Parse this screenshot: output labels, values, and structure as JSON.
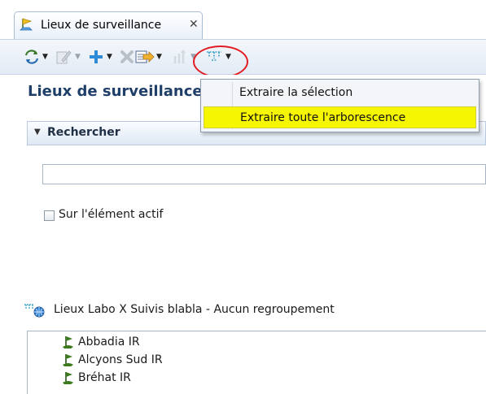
{
  "tab": {
    "label": "Lieux de surveillance",
    "close_glyph": "✕",
    "icon": "flag-icon"
  },
  "toolbar": {
    "buttons": [
      {
        "icon": "refresh-icon"
      },
      {
        "icon": "edit-icon",
        "disabled": true
      },
      {
        "icon": "add-icon"
      },
      {
        "icon": "delete-icon",
        "disabled": true
      },
      {
        "icon": "export-icon"
      },
      {
        "icon": "move-icon",
        "disabled": true
      },
      {
        "icon": "filter-tree-icon"
      }
    ],
    "highlight_color": "#e31b23"
  },
  "view": {
    "title": "Lieux de surveillance"
  },
  "search": {
    "section_label": "Rechercher",
    "input_value": "",
    "checkbox_label": "Sur l'élément actif",
    "checkbox_checked": false
  },
  "tree": {
    "root_label": "Lieux Labo X Suivis blabla   - Aucun regroupement",
    "items": [
      {
        "label": "Abbadia IR"
      },
      {
        "label": "Alcyons Sud IR"
      },
      {
        "label": "Bréhat IR"
      }
    ]
  },
  "menu": {
    "items": [
      {
        "label": "Extraire la sélection",
        "highlighted": false
      },
      {
        "label": "Extraire toute l'arborescence",
        "highlighted": true
      }
    ],
    "highlight_color": "#f6f600"
  }
}
